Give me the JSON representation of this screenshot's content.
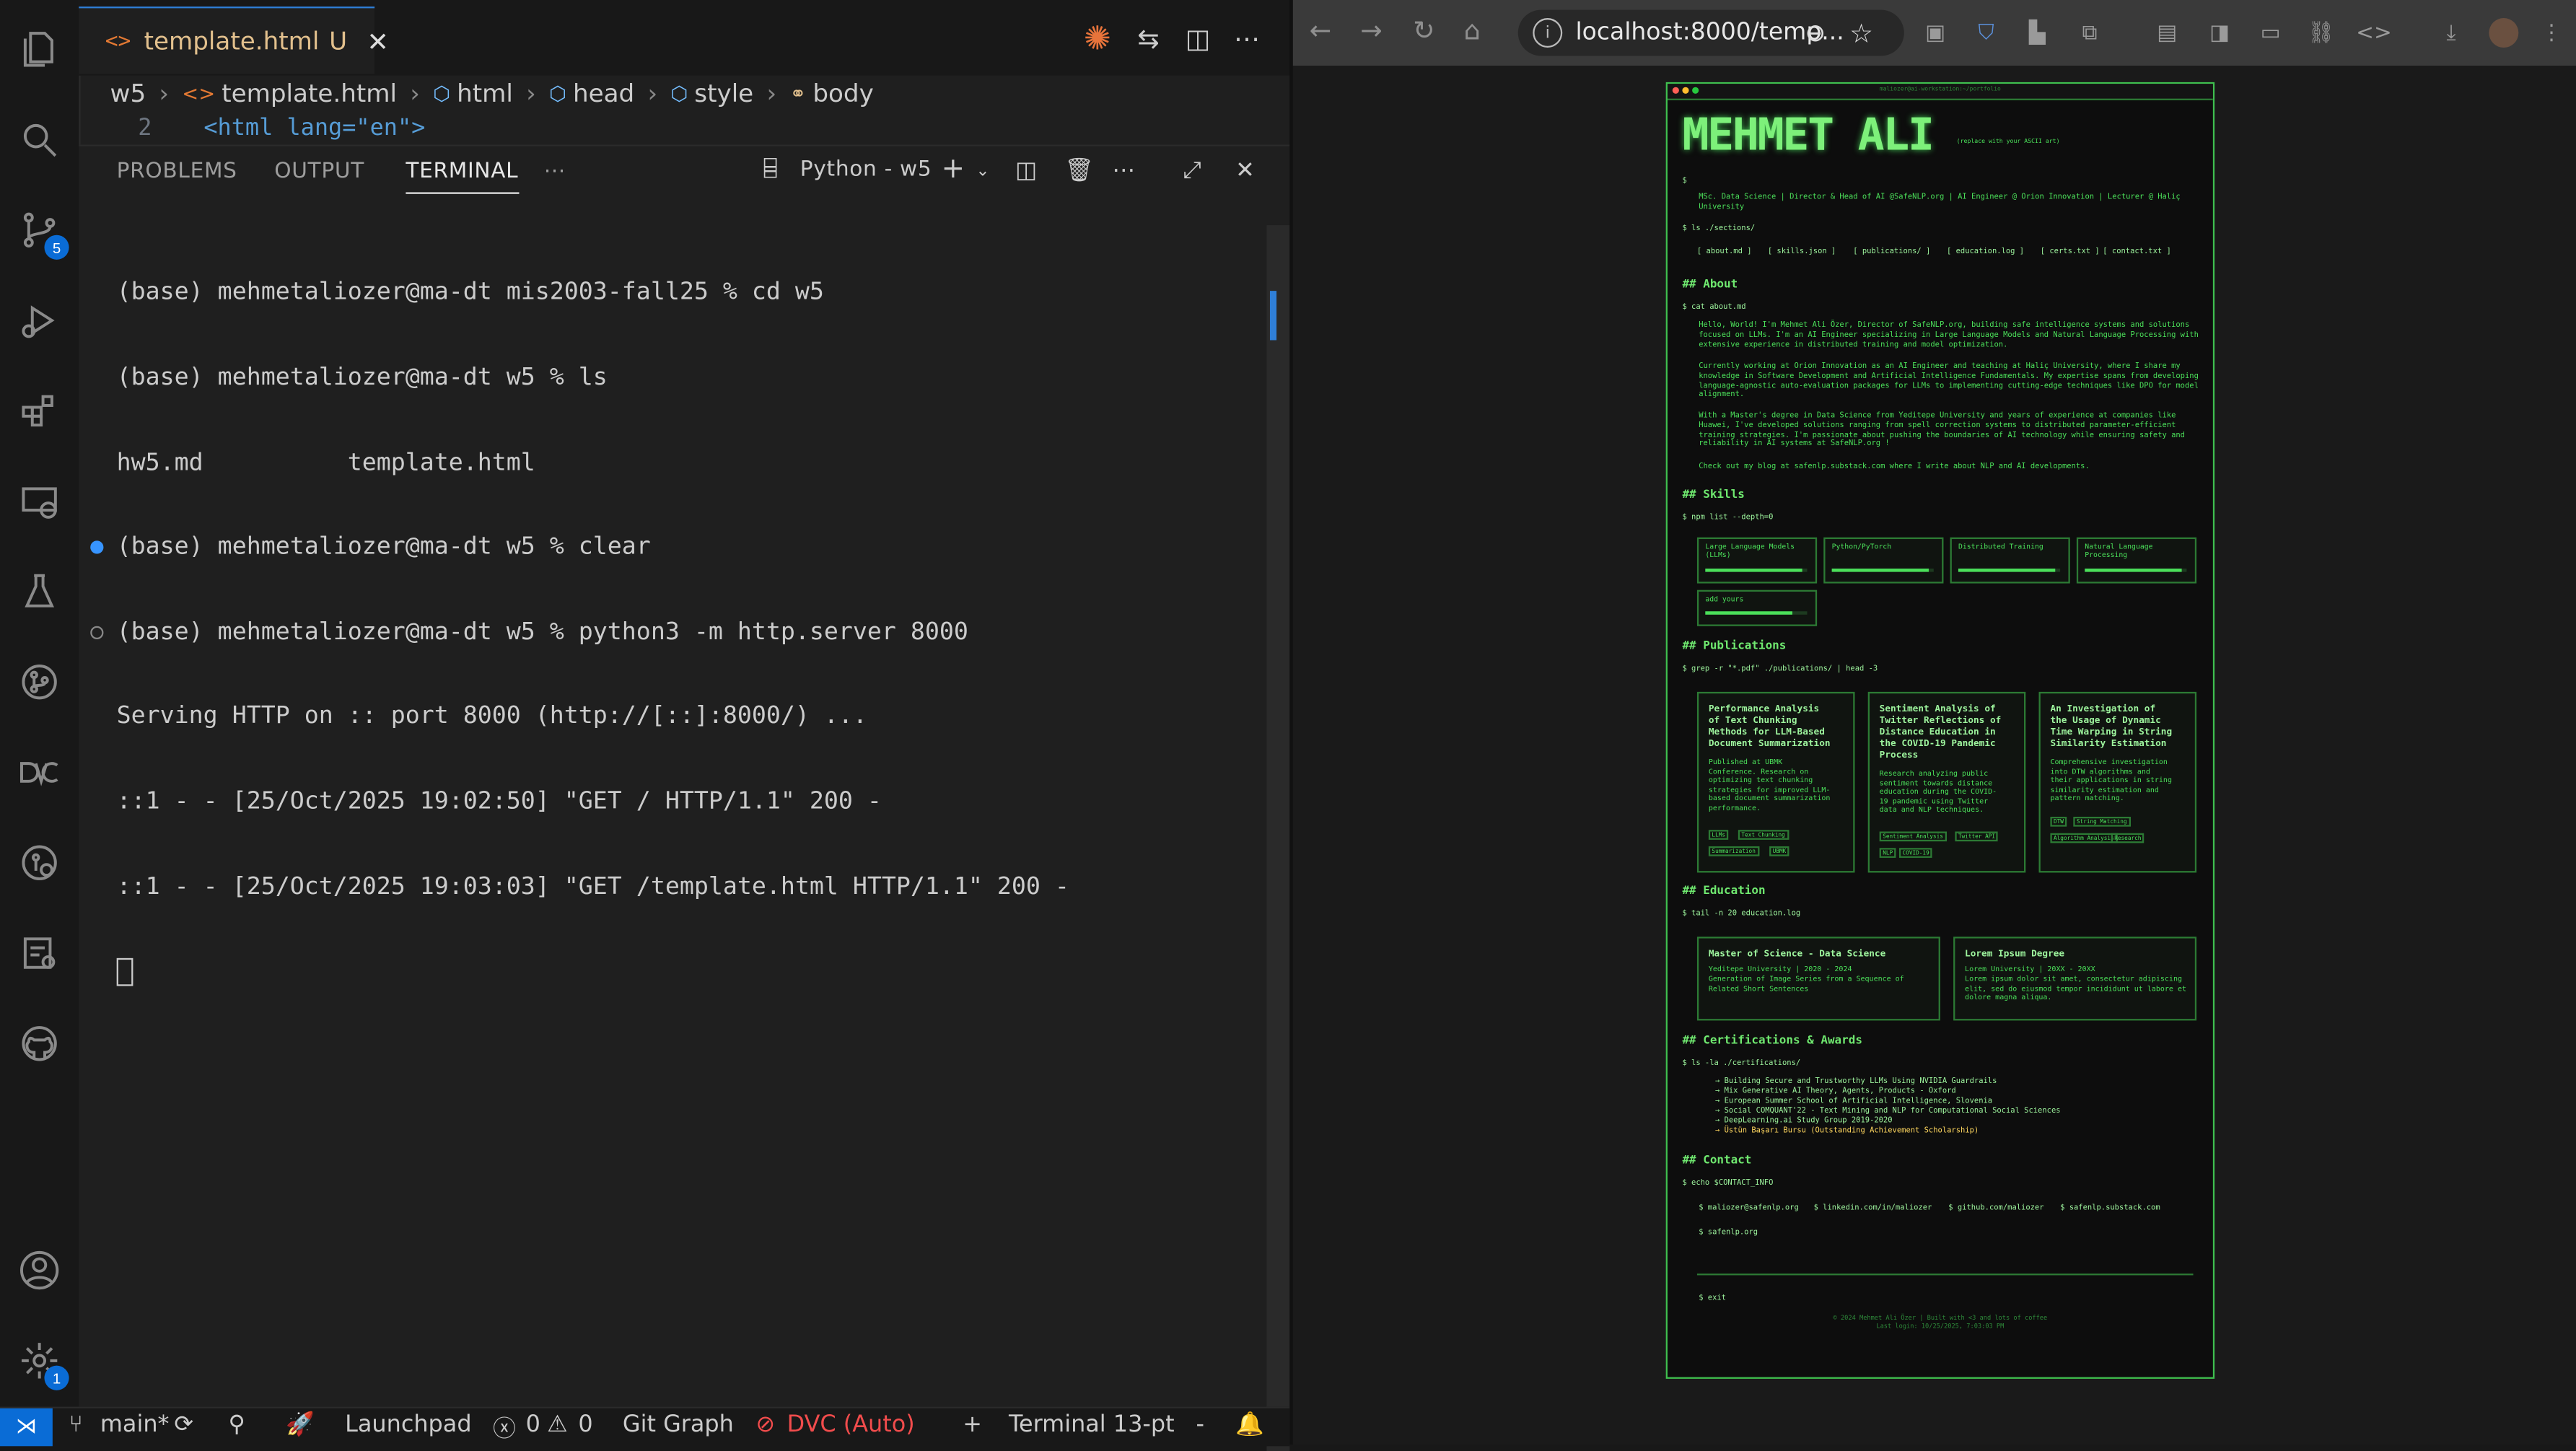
{
  "vscode": {
    "tab": {
      "icon": "<>",
      "name": "template.html",
      "status": "U"
    },
    "breadcrumb": [
      "w5",
      "template.html",
      "html",
      "head",
      "style",
      "body"
    ],
    "code_line": {
      "number": "2",
      "text": "<html lang=\"en\">"
    },
    "activity_badges": {
      "source_control": "5",
      "settings": "1"
    },
    "panel": {
      "tabs": [
        "PROBLEMS",
        "OUTPUT",
        "TERMINAL"
      ],
      "active_tab": "TERMINAL",
      "terminal_name": "Python - w5"
    },
    "terminal_lines": [
      "(base) mehmetaliozer@ma-dt mis2003-fall25 % cd w5",
      "(base) mehmetaliozer@ma-dt w5 % ls",
      "hw5.md          template.html",
      "(base) mehmetaliozer@ma-dt w5 % clear",
      "(base) mehmetaliozer@ma-dt w5 % python3 -m http.server 8000",
      "Serving HTTP on :: port 8000 (http://[::]:8000/) ...",
      "::1 - - [25/Oct/2025 19:02:50] \"GET / HTTP/1.1\" 200 -",
      "::1 - - [25/Oct/2025 19:03:03] \"GET /template.html HTTP/1.1\" 200 -"
    ],
    "status_bar": {
      "branch": "main*",
      "launchpad": "Launchpad",
      "errors": "0",
      "warnings": "0",
      "git_graph": "Git Graph",
      "dvc": "DVC (Auto)",
      "terminal_font": "Terminal 13-pt",
      "plus": "+",
      "minus": "-"
    }
  },
  "browser": {
    "url": "localhost:8000/temp...",
    "page": {
      "window_title": "maliozer@ai-workstation:~/portfolio",
      "name": "MEHMET ALI",
      "ascii_note": "(replace with your ASCII art)",
      "prompt_sign": "$",
      "tagline": "MSc. Data Science | Director & Head of AI @SafeNLP.org | AI Engineer @ Orion Innovation | Lecturer @ Haliç University",
      "sections_cmd": "$ ls ./sections/",
      "nav": [
        "[ about.md ]",
        "[ skills.json ]",
        "[ publications/ ]",
        "[ education.log ]",
        "[ certs.txt ]",
        "[ contact.txt ]"
      ],
      "about": {
        "heading": "## About",
        "cmd": "$ cat about.md",
        "paragraphs": [
          "Hello, World! I'm Mehmet Ali Özer, Director of SafeNLP.org, building safe intelligence systems and solutions focused on LLMs. I'm an AI Engineer specializing in Large Language Models and Natural Language Processing with extensive experience in distributed training and model optimization.",
          "Currently working at Orion Innovation as an AI Engineer and teaching at Haliç University, where I share my knowledge in Software Development and Artificial Intelligence Fundamentals. My expertise spans from developing language-agnostic auto-evaluation packages for LLMs to implementing cutting-edge techniques like DPO for model alignment.",
          "With a Master's degree in Data Science from Yeditepe University and years of experience at companies like Huawei, I've developed solutions ranging from spell correction systems to distributed parameter-efficient training strategies. I'm passionate about pushing the boundaries of AI technology while ensuring safety and reliability in AI systems at SafeNLP.org !",
          "Check out my blog at safenlp.substack.com where I write about NLP and AI developments."
        ]
      },
      "skills": {
        "heading": "## Skills",
        "cmd": "$ npm list --depth=0",
        "items": [
          {
            "label": "Large Language Models (LLMs)",
            "level": 0.95
          },
          {
            "label": "Python/PyTorch",
            "level": 0.95
          },
          {
            "label": "Distributed Training",
            "level": 0.95
          },
          {
            "label": "Natural Language Processing",
            "level": 0.95
          },
          {
            "label": "add yours",
            "level": 0.85
          }
        ]
      },
      "publications": {
        "heading": "## Publications",
        "cmd": "$ grep -r \"*.pdf\" ./publications/ | head -3",
        "items": [
          {
            "title": "Performance Analysis of Text Chunking Methods for LLM-Based Document Summarization",
            "desc": "Published at UBMK Conference. Research on optimizing text chunking strategies for improved LLM-based document summarization performance.",
            "tags": [
              "LLMs",
              "Text Chunking",
              "Summarization",
              "UBMK"
            ]
          },
          {
            "title": "Sentiment Analysis of Twitter Reflections of Distance Education in the COVID-19 Pandemic Process",
            "desc": "Research analyzing public sentiment towards distance education during the COVID-19 pandemic using Twitter data and NLP techniques.",
            "tags": [
              "Sentiment Analysis",
              "Twitter API",
              "NLP",
              "COVID-19"
            ]
          },
          {
            "title": "An Investigation of the Usage of Dynamic Time Warping in String Similarity Estimation",
            "desc": "Comprehensive investigation into DTW algorithms and their applications in string similarity estimation and pattern matching.",
            "tags": [
              "DTW",
              "String Matching",
              "Algorithm Analysis",
              "Research"
            ]
          }
        ]
      },
      "education": {
        "heading": "## Education",
        "cmd": "$ tail -n 20 education.log",
        "items": [
          {
            "title": "Master of Science - Data Science",
            "meta": "Yeditepe University | 2020 - 2024",
            "desc": "Generation of Image Series from a Sequence of Related Short Sentences"
          },
          {
            "title": "Lorem Ipsum Degree",
            "meta": "Lorem University | 20XX - 20XX",
            "desc": "Lorem ipsum dolor sit amet, consectetur adipiscing elit, sed do eiusmod tempor incididunt ut labore et dolore magna aliqua."
          }
        ]
      },
      "certs": {
        "heading": "## Certifications & Awards",
        "cmd": "$ ls -la ./certifications/",
        "items": [
          "→ Building Secure and Trustworthy LLMs Using NVIDIA Guardrails",
          "→ Mix Generative AI Theory, Agents, Products - Oxford",
          "→ European Summer School of Artificial Intelligence, Slovenia",
          "→ Social COMQUANT'22 - Text Mining and NLP for Computational Social Sciences",
          "→ DeepLearning.ai Study Group 2019-2020",
          "→ Üstün Başarı Bursu (Outstanding Achievement Scholarship)"
        ]
      },
      "contact": {
        "heading": "## Contact",
        "cmd": "$ echo $CONTACT_INFO",
        "links": [
          "$ maliozer@safenlp.org",
          "$ linkedin.com/in/maliozer",
          "$ github.com/maliozer",
          "$ safenlp.substack.com",
          "$ safenlp.org"
        ]
      },
      "exit": "$ exit",
      "footer": [
        "© 2024 Mehmet Ali Özer | Built with <3 and lots of coffee",
        "Last login: 10/25/2025, 7:03:03 PM"
      ]
    }
  }
}
